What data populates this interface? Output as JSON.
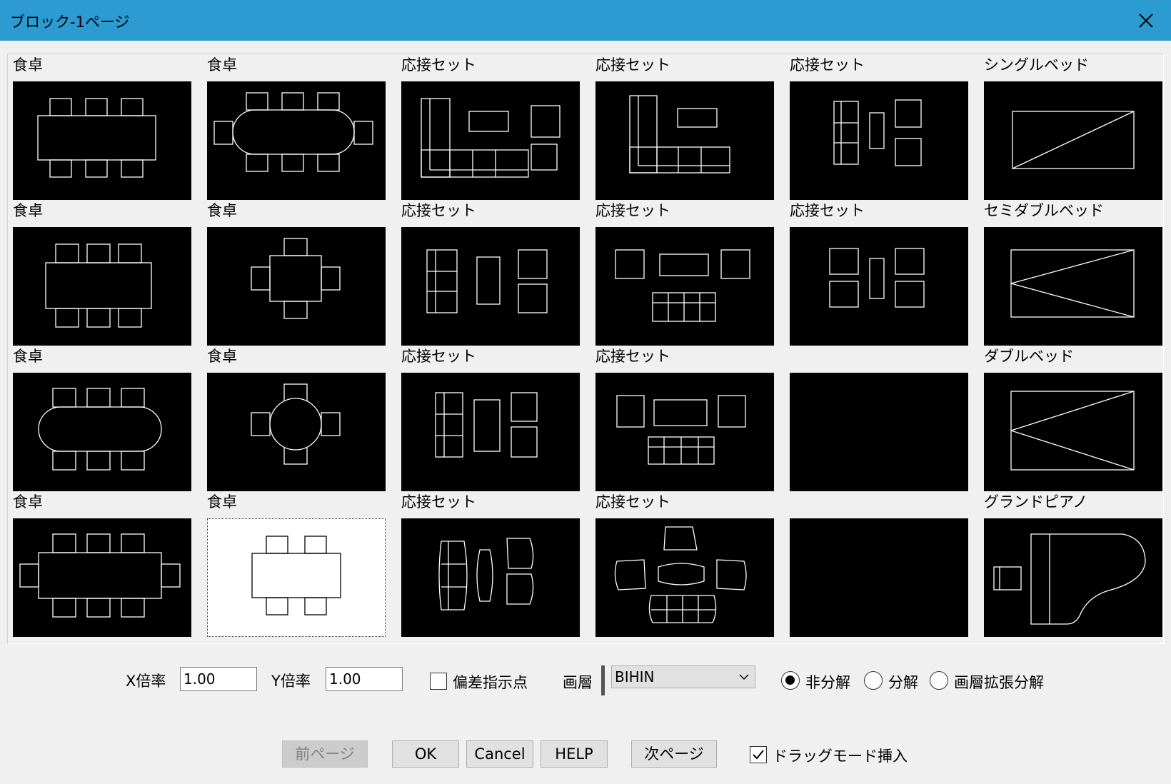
{
  "window": {
    "title": "ブロック-1ページ",
    "close_glyph": "✕"
  },
  "grid": {
    "labels": [
      [
        "食卓",
        "食卓",
        "応接セット",
        "応接セット",
        "応接セット",
        "シングルベッド"
      ],
      [
        "食卓",
        "食卓",
        "応接セット",
        "応接セット",
        "応接セット",
        "セミダブルベッド"
      ],
      [
        "食卓",
        "食卓",
        "応接セット",
        "応接セット",
        "",
        "ダブルベッド"
      ],
      [
        "食卓",
        "食卓",
        "応接セット",
        "応接セット",
        "",
        "グランドピアノ"
      ]
    ],
    "selected": [
      3,
      1
    ]
  },
  "controls": {
    "x_scale_label": "X倍率",
    "x_scale_value": "1.00",
    "y_scale_label": "Y倍率",
    "y_scale_value": "1.00",
    "offset_point_label": "偏差指示点",
    "offset_point_checked": false,
    "layer_label": "画層",
    "layer_value": "BIHIN",
    "radio_options": [
      "非分解",
      "分解",
      "画層拡張分解"
    ],
    "radio_selected": 0
  },
  "buttons": {
    "prev_page": "前ページ",
    "ok": "OK",
    "cancel": "Cancel",
    "help": "HELP",
    "next_page": "次ページ",
    "drag_mode_label": "ドラッグモード挿入",
    "drag_mode_checked": true
  },
  "colors": {
    "titlebar": "#2b9bd1",
    "thumb_bg": "#000000",
    "thumb_line": "#ffffff",
    "selected_bg": "#ffffff"
  }
}
